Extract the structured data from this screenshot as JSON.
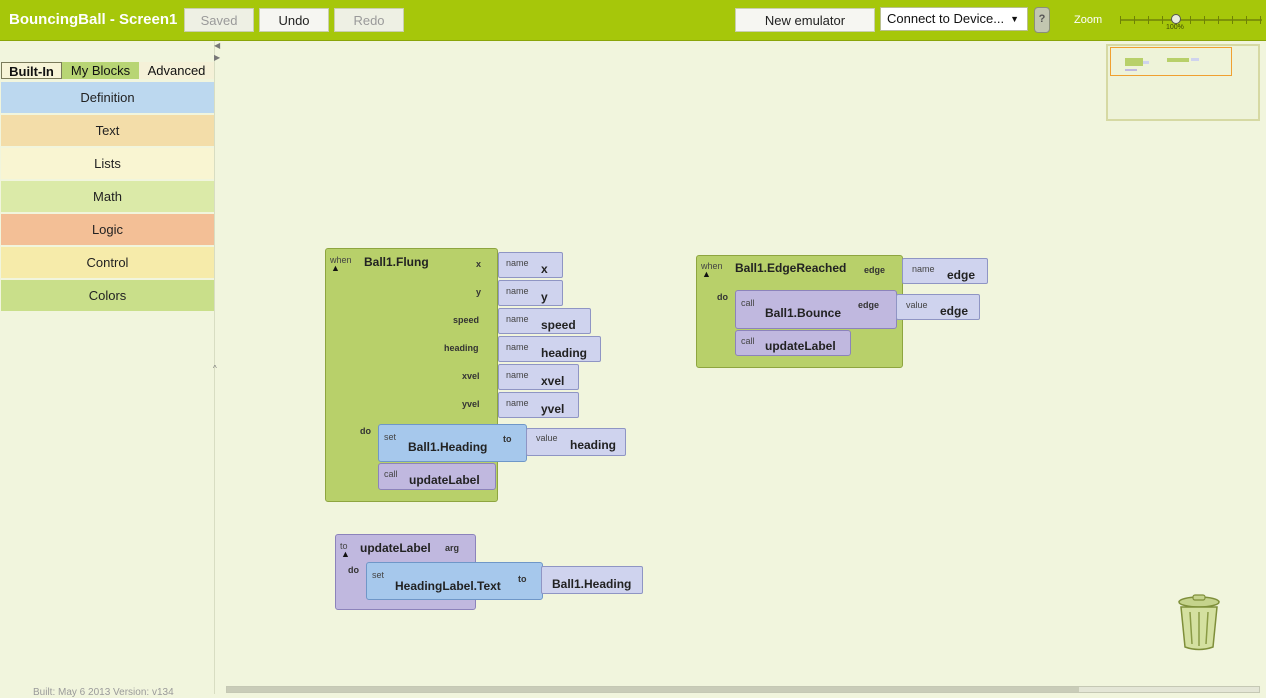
{
  "app": {
    "title": "BouncingBall - Screen1"
  },
  "toolbar": {
    "saved": "Saved",
    "undo": "Undo",
    "redo": "Redo",
    "new_emulator": "New emulator",
    "connect": "Connect to Device...",
    "help": "?",
    "zoom_label": "Zoom",
    "zoom_pct": "100%"
  },
  "palette": {
    "tabs": [
      "Built-In",
      "My Blocks",
      "Advanced"
    ],
    "categories": [
      {
        "label": "Definition",
        "color": "#bcd8ef"
      },
      {
        "label": "Text",
        "color": "#f3dda9"
      },
      {
        "label": "Lists",
        "color": "#f9f5d2"
      },
      {
        "label": "Math",
        "color": "#dbeaa8"
      },
      {
        "label": "Logic",
        "color": "#f3bf96"
      },
      {
        "label": "Control",
        "color": "#f6ebaa"
      },
      {
        "label": "Colors",
        "color": "#c9df8a"
      }
    ],
    "footer": "Built: May 6 2013 Version: v134"
  },
  "flung": {
    "when": "when",
    "event": "Ball1.Flung",
    "do": "do",
    "params": [
      {
        "label": "x",
        "name_tag": "name",
        "value": "x"
      },
      {
        "label": "y",
        "name_tag": "name",
        "value": "y"
      },
      {
        "label": "speed",
        "name_tag": "name",
        "value": "speed"
      },
      {
        "label": "heading",
        "name_tag": "name",
        "value": "heading"
      },
      {
        "label": "xvel",
        "name_tag": "name",
        "value": "xvel"
      },
      {
        "label": "yvel",
        "name_tag": "name",
        "value": "yvel"
      }
    ],
    "set_tag": "set",
    "set_target": "Ball1.Heading",
    "to": "to",
    "value_tag": "value",
    "value_name": "heading",
    "call_tag": "call",
    "call_name": "updateLabel"
  },
  "edge": {
    "when": "when",
    "event": "Ball1.EdgeReached",
    "param_label": "edge",
    "name_tag": "name",
    "param_value": "edge",
    "do": "do",
    "call_tag": "call",
    "bounce": "Ball1.Bounce",
    "bounce_arg": "edge",
    "value_tag": "value",
    "value_name": "edge",
    "call2_tag": "call",
    "call2_name": "updateLabel"
  },
  "proc": {
    "to": "to",
    "name": "updateLabel",
    "arg": "arg",
    "do": "do",
    "set_tag": "set",
    "set_target": "HeadingLabel.Text",
    "to_kw": "to",
    "value": "Ball1.Heading"
  }
}
